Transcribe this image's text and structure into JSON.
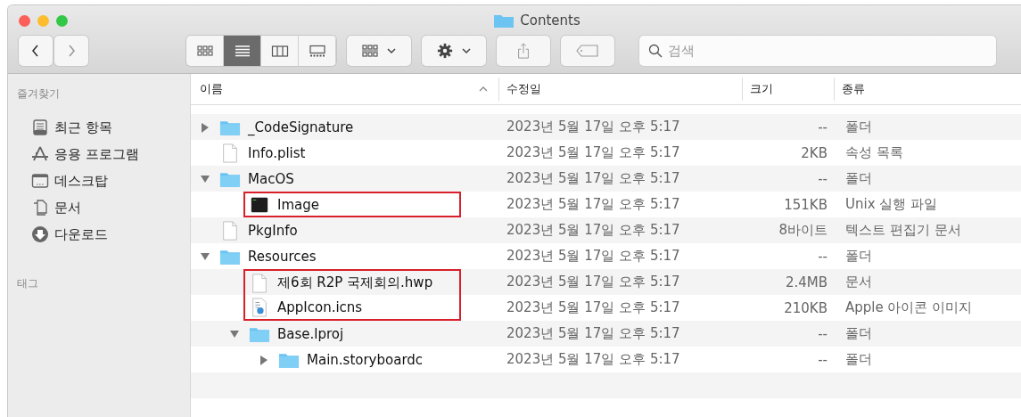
{
  "window": {
    "title": "Contents"
  },
  "toolbar": {
    "view_modes": [
      {
        "kind": "icons",
        "selected": false
      },
      {
        "kind": "list",
        "selected": true
      },
      {
        "kind": "columns",
        "selected": false
      },
      {
        "kind": "gallery",
        "selected": false
      }
    ],
    "search": {
      "placeholder": "검색"
    }
  },
  "sidebar": {
    "sections": [
      {
        "title": "즐겨찾기",
        "items": [
          {
            "label": "최근 항목"
          },
          {
            "label": "응용 프로그램"
          },
          {
            "label": "데스크탑"
          },
          {
            "label": "문서"
          },
          {
            "label": "다운로드"
          }
        ]
      },
      {
        "title": "태그"
      }
    ]
  },
  "table": {
    "columns": [
      {
        "label": "이름",
        "sorted": true
      },
      {
        "label": "수정일",
        "sorted": false
      },
      {
        "label": "크기",
        "sorted": false
      },
      {
        "label": "종류",
        "sorted": false
      }
    ],
    "rows": [
      {
        "name": "_CodeSignature",
        "kind": "folder",
        "expanded": false,
        "highlighted": false,
        "modified": "2023년 5월 17일 오후 5:17",
        "size": "--",
        "type": "폴더"
      },
      {
        "name": "Info.plist",
        "kind": "file",
        "highlighted": false,
        "modified": "2023년 5월 17일 오후 5:17",
        "size": "2KB",
        "type": "속성 목록"
      },
      {
        "name": "MacOS",
        "kind": "folder",
        "expanded": true,
        "highlighted": false,
        "modified": "2023년 5월 17일 오후 5:17",
        "size": "--",
        "type": "폴더",
        "children": [
          {
            "name": "Image",
            "kind": "executable",
            "highlighted": true,
            "modified": "2023년 5월 17일 오후 5:17",
            "size": "151KB",
            "type": "Unix 실행 파일"
          }
        ]
      },
      {
        "name": "PkgInfo",
        "kind": "file",
        "highlighted": false,
        "modified": "2023년 5월 17일 오후 5:17",
        "size": "8바이트",
        "type": "텍스트 편집기 문서"
      },
      {
        "name": "Resources",
        "kind": "folder",
        "expanded": true,
        "highlighted": false,
        "modified": "2023년 5월 17일 오후 5:17",
        "size": "--",
        "type": "폴더",
        "children": [
          {
            "name": "제6회 R2P 국제회의.hwp",
            "kind": "file",
            "highlighted": true,
            "modified": "2023년 5월 17일 오후 5:17",
            "size": "2.4MB",
            "type": "문서"
          },
          {
            "name": "AppIcon.icns",
            "kind": "icns",
            "highlighted": true,
            "modified": "2023년 5월 17일 오후 5:17",
            "size": "210KB",
            "type": "Apple 아이콘 이미지"
          },
          {
            "name": "Base.lproj",
            "kind": "folder",
            "expanded": true,
            "highlighted": false,
            "modified": "2023년 5월 17일 오후 5:17",
            "size": "--",
            "type": "폴더",
            "children": [
              {
                "name": "Main.storyboardc",
                "kind": "folder",
                "expanded": false,
                "highlighted": false,
                "modified": "2023년 5월 17일 오후 5:17",
                "size": "--",
                "type": "폴더"
              }
            ]
          }
        ]
      }
    ]
  }
}
